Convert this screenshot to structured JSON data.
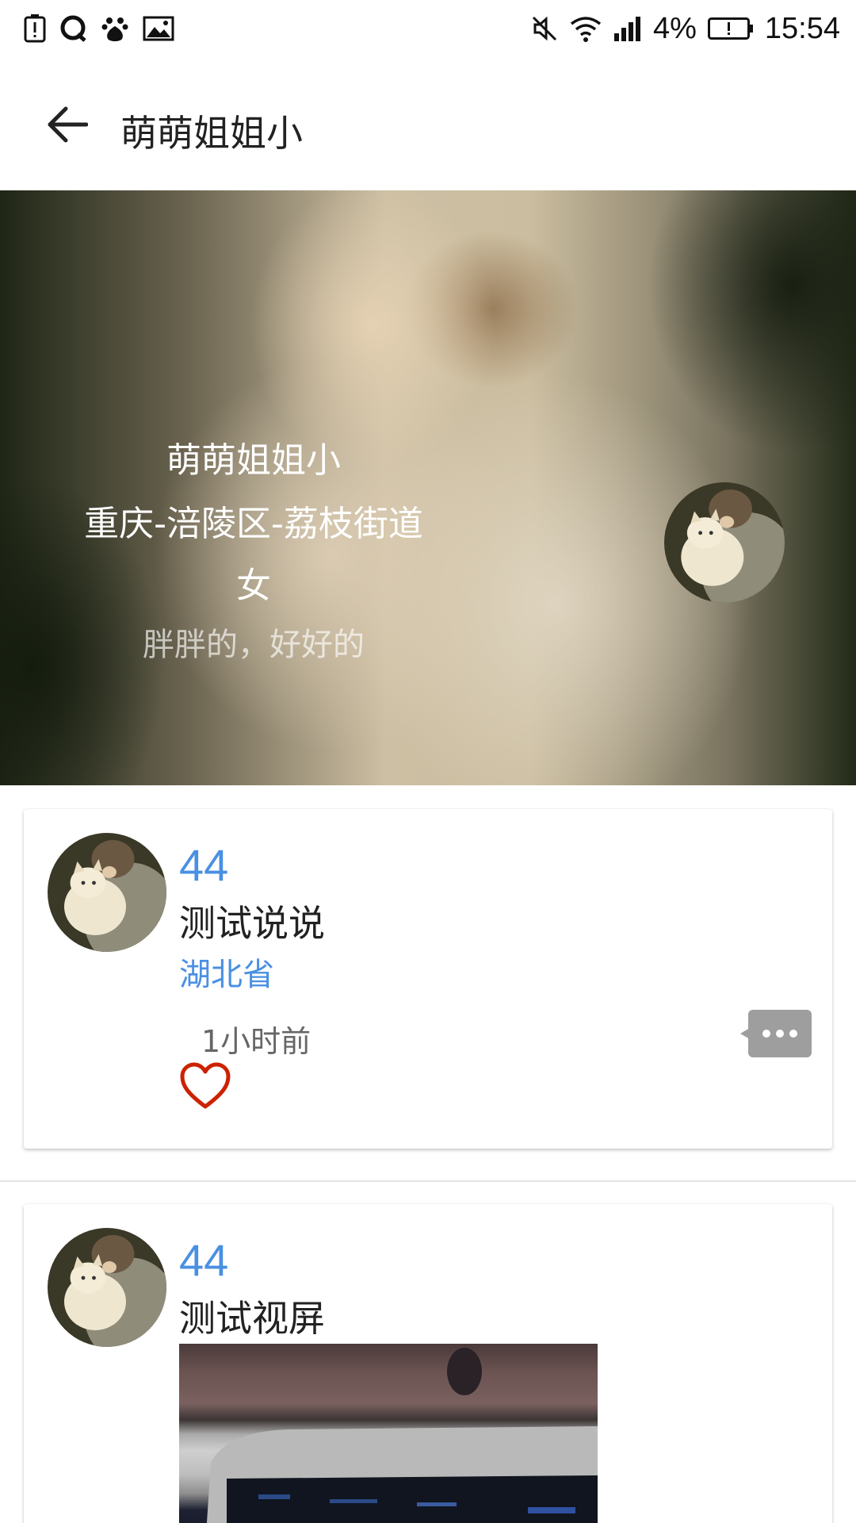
{
  "status_bar": {
    "battery_percent": "4%",
    "time": "15:54",
    "left_icons": [
      "alert-icon",
      "qq-icon",
      "baidu-icon",
      "image-icon"
    ],
    "right_icons": [
      "mute-icon",
      "wifi-icon",
      "signal-icon",
      "battery-icon"
    ]
  },
  "header": {
    "title": "萌萌姐姐小"
  },
  "cover": {
    "name": "萌萌姐姐小",
    "location": "重庆-涪陵区-荔枝街道",
    "gender": "女",
    "signature": "胖胖的，好好的"
  },
  "posts": [
    {
      "author": "44",
      "text": "测试说说",
      "location": "湖北省",
      "time": "1小时前",
      "liked": false
    },
    {
      "author": "44",
      "text": "测试视屏"
    }
  ],
  "colors": {
    "accent": "#4a90e2",
    "like": "#cc2200",
    "more_button_bg": "#9e9e9e"
  }
}
